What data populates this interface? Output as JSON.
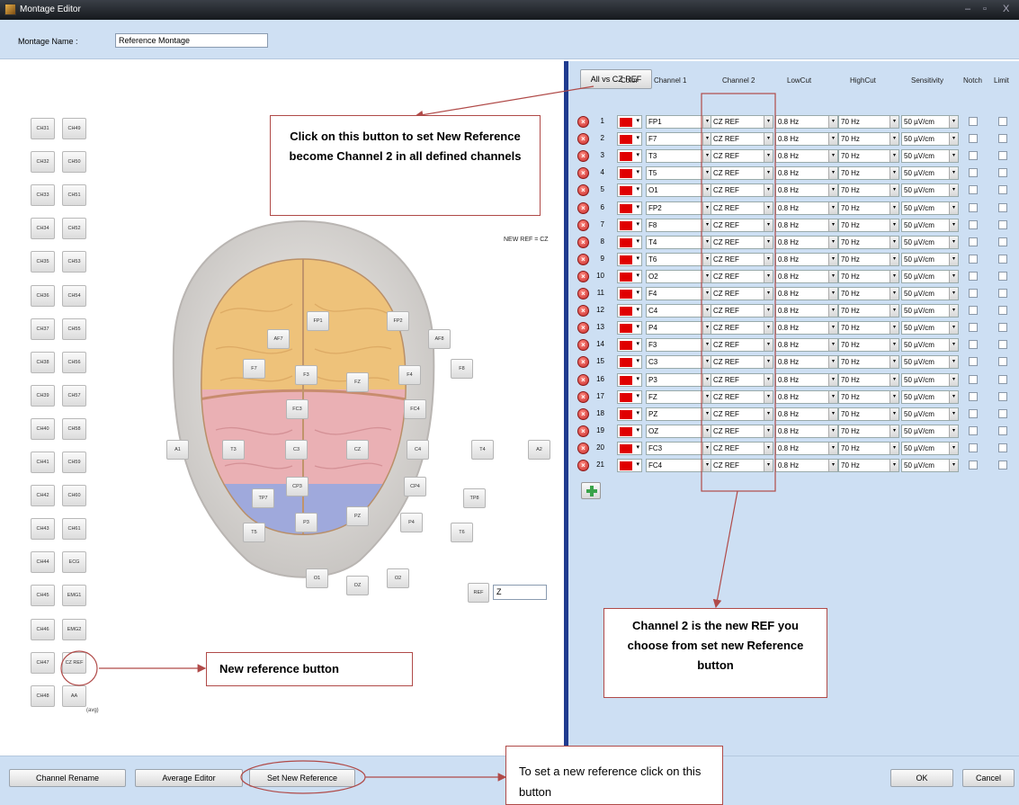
{
  "window": {
    "title": "Montage Editor",
    "min": "–",
    "max": "▫",
    "close": "X"
  },
  "header": {
    "name_label": "Montage Name :",
    "name_value": "Reference Montage"
  },
  "left": {
    "channels_col1": [
      "CH31",
      "CH32",
      "CH33",
      "CH34",
      "CH35",
      "CH36",
      "CH37",
      "CH38",
      "CH39",
      "CH40",
      "CH41",
      "CH42",
      "CH43",
      "CH44",
      "CH45",
      "CH46",
      "CH47",
      "CH48"
    ],
    "channels_col2": [
      "CH49",
      "CH50",
      "CH51",
      "CH52",
      "CH53",
      "CH54",
      "CH55",
      "CH56",
      "CH57",
      "CH58",
      "CH59",
      "CH60",
      "CH61",
      "ECG",
      "EMG1",
      "EMG2",
      "CZ REF",
      "AA"
    ],
    "avg_note": "(avg)",
    "new_ref_label": "NEW REF = CZ",
    "ref_button": "REF",
    "ref_value": "Z",
    "electrodes": [
      {
        "id": "FP1",
        "label": "FP1"
      },
      {
        "id": "FP2",
        "label": "FP2"
      },
      {
        "id": "AF7",
        "label": "AF7"
      },
      {
        "id": "AF8",
        "label": "AF8"
      },
      {
        "id": "F7",
        "label": "F7"
      },
      {
        "id": "F3",
        "label": "F3"
      },
      {
        "id": "FZ-front",
        "label": "FZ"
      },
      {
        "id": "F4",
        "label": "F4"
      },
      {
        "id": "F8",
        "label": "F8"
      },
      {
        "id": "FC3",
        "label": "FC3"
      },
      {
        "id": "FC4",
        "label": "FC4"
      },
      {
        "id": "A1",
        "label": "A1"
      },
      {
        "id": "T3",
        "label": "T3"
      },
      {
        "id": "C3",
        "label": "C3"
      },
      {
        "id": "CZ",
        "label": "CZ"
      },
      {
        "id": "C4",
        "label": "C4"
      },
      {
        "id": "T4",
        "label": "T4"
      },
      {
        "id": "A2",
        "label": "A2"
      },
      {
        "id": "CP3",
        "label": "CP3"
      },
      {
        "id": "CP4",
        "label": "CP4"
      },
      {
        "id": "TP7",
        "label": "TP7"
      },
      {
        "id": "TP8",
        "label": "TP8"
      },
      {
        "id": "PZ",
        "label": "PZ"
      },
      {
        "id": "P3",
        "label": "P3"
      },
      {
        "id": "P4",
        "label": "P4"
      },
      {
        "id": "T5",
        "label": "T5"
      },
      {
        "id": "T6",
        "label": "T6"
      },
      {
        "id": "O1",
        "label": "O1"
      },
      {
        "id": "OZ",
        "label": "OZ"
      },
      {
        "id": "O2",
        "label": "O2"
      }
    ]
  },
  "right": {
    "all_vs_button": "All vs CZ REF",
    "columns": {
      "color": "Color",
      "ch1": "Channel 1",
      "ch2": "Channel 2",
      "lowcut": "LowCut",
      "highcut": "HighCut",
      "sens": "Sensitivity",
      "notch": "Notch",
      "limit": "Limit"
    },
    "rows": [
      {
        "n": "1",
        "ch1": "FP1"
      },
      {
        "n": "2",
        "ch1": "F7"
      },
      {
        "n": "3",
        "ch1": "T3"
      },
      {
        "n": "4",
        "ch1": "T5"
      },
      {
        "n": "5",
        "ch1": "O1"
      },
      {
        "n": "6",
        "ch1": "FP2"
      },
      {
        "n": "7",
        "ch1": "F8"
      },
      {
        "n": "8",
        "ch1": "T4"
      },
      {
        "n": "9",
        "ch1": "T6"
      },
      {
        "n": "10",
        "ch1": "O2"
      },
      {
        "n": "11",
        "ch1": "F4"
      },
      {
        "n": "12",
        "ch1": "C4"
      },
      {
        "n": "13",
        "ch1": "P4"
      },
      {
        "n": "14",
        "ch1": "F3"
      },
      {
        "n": "15",
        "ch1": "C3"
      },
      {
        "n": "16",
        "ch1": "P3"
      },
      {
        "n": "17",
        "ch1": "FZ"
      },
      {
        "n": "18",
        "ch1": "PZ"
      },
      {
        "n": "19",
        "ch1": "OZ"
      },
      {
        "n": "20",
        "ch1": "FC3"
      },
      {
        "n": "21",
        "ch1": "FC4"
      }
    ],
    "ch2_value": "CZ REF",
    "lowcut_value": "0.8 Hz",
    "highcut_value": "70 Hz",
    "sens_value": "50 µV/cm",
    "row_color": "#e00000"
  },
  "footer": {
    "channel_rename": "Channel Rename",
    "average_editor": "Average Editor",
    "set_new_reference": "Set New Reference",
    "ok": "OK",
    "cancel": "Cancel"
  },
  "annotations": {
    "all_vs_callout": "Click on this button to set New Reference become Channel 2 in all defined channels",
    "channel2_callout": "Channel 2 is the new REF you choose from set new Reference button",
    "new_ref_callout": "New reference button",
    "set_ref_callout": "To set a new reference click on this button",
    "accent": "#b04a48"
  }
}
